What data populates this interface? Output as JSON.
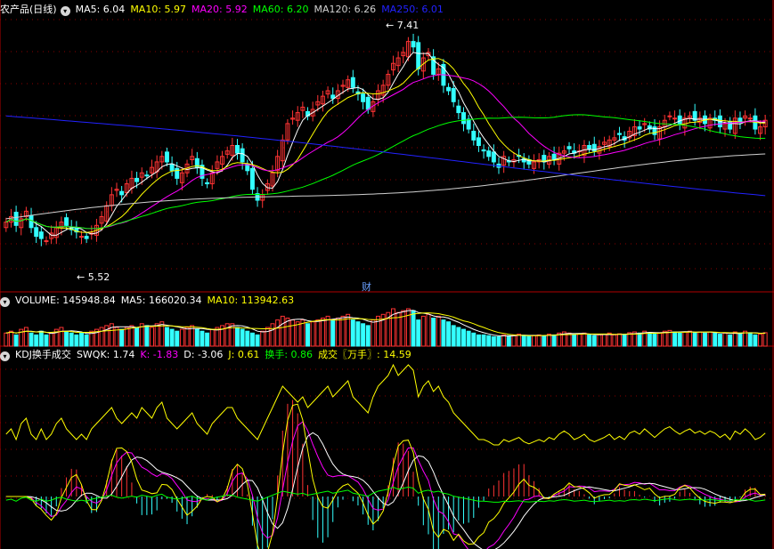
{
  "price_panel": {
    "title": "农产品(日线)",
    "ma": [
      {
        "label": "MA5: 6.04",
        "color": "#ffffff"
      },
      {
        "label": "MA10: 5.97",
        "color": "#ffff00"
      },
      {
        "label": "MA20: 5.92",
        "color": "#ff00ff"
      },
      {
        "label": "MA60: 6.20",
        "color": "#00ff00"
      },
      {
        "label": "MA120: 6.26",
        "color": "#d0d0d0"
      },
      {
        "label": "MA250: 6.01",
        "color": "#2222ff"
      }
    ],
    "high_label": "7.41",
    "low_label": "5.52",
    "marker": "财"
  },
  "volume_panel": {
    "items": [
      {
        "label": "VOLUME: 145948.84",
        "color": "#ffffff"
      },
      {
        "label": "MA5: 166020.34",
        "color": "#ffffff"
      },
      {
        "label": "MA10: 113942.63",
        "color": "#ffff00"
      }
    ]
  },
  "kdj_panel": {
    "items": [
      {
        "label": "KDJ换手成交",
        "color": "#ffffff"
      },
      {
        "label": "SWQK: 1.74",
        "color": "#ffffff"
      },
      {
        "label": "K: -1.83",
        "color": "#ff00ff"
      },
      {
        "label": "D: -3.06",
        "color": "#ffffff"
      },
      {
        "label": "J: 0.61",
        "color": "#ffff00"
      },
      {
        "label": "换手: 0.86",
        "color": "#00ff00"
      },
      {
        "label": "成交〖万手〗: 14.59",
        "color": "#ffff00"
      }
    ]
  },
  "chart_data": {
    "type": "candlestick",
    "colors": {
      "up": "#ff3333",
      "down": "#33ffff",
      "ma5": "#ffffff",
      "ma10": "#ffff00",
      "ma20": "#ff00ff",
      "ma60": "#00ff00",
      "ma120": "#d0d0d0",
      "ma250": "#2222ff"
    },
    "price_range": [
      5.3,
      7.6
    ],
    "closes": [
      5.75,
      5.8,
      5.72,
      5.78,
      5.85,
      5.7,
      5.62,
      5.6,
      5.58,
      5.65,
      5.7,
      5.75,
      5.72,
      5.68,
      5.66,
      5.62,
      5.6,
      5.65,
      5.72,
      5.8,
      5.9,
      6.0,
      6.05,
      6.0,
      6.1,
      6.15,
      6.12,
      6.2,
      6.18,
      6.25,
      6.3,
      6.35,
      6.3,
      6.22,
      6.15,
      6.2,
      6.28,
      6.35,
      6.25,
      6.15,
      6.1,
      6.2,
      6.3,
      6.35,
      6.4,
      6.45,
      6.38,
      6.3,
      6.22,
      6.05,
      5.95,
      6.0,
      6.1,
      6.2,
      6.35,
      6.5,
      6.65,
      6.7,
      6.75,
      6.8,
      6.72,
      6.78,
      6.85,
      6.9,
      6.95,
      6.88,
      6.95,
      7.0,
      7.05,
      6.98,
      6.92,
      6.85,
      6.78,
      6.85,
      6.95,
      7.0,
      7.1,
      7.2,
      7.25,
      7.3,
      7.4,
      7.35,
      7.15,
      7.25,
      7.3,
      7.1,
      7.15,
      7.0,
      6.95,
      6.85,
      6.75,
      6.65,
      6.6,
      6.5,
      6.45,
      6.4,
      6.35,
      6.3,
      6.25,
      6.35,
      6.3,
      6.32,
      6.35,
      6.3,
      6.28,
      6.3,
      6.32,
      6.3,
      6.35,
      6.32,
      6.38,
      6.4,
      6.42,
      6.38,
      6.4,
      6.45,
      6.42,
      6.4,
      6.44,
      6.48,
      6.5,
      6.52,
      6.55,
      6.5,
      6.58,
      6.62,
      6.6,
      6.65,
      6.6,
      6.55,
      6.62,
      6.68,
      6.72,
      6.7,
      6.65,
      6.7,
      6.72,
      6.68,
      6.7,
      6.65,
      6.7,
      6.68,
      6.62,
      6.65,
      6.6,
      6.7,
      6.66,
      6.72,
      6.7,
      6.6,
      6.62,
      6.68
    ],
    "volumes": [
      0.35,
      0.4,
      0.3,
      0.45,
      0.5,
      0.35,
      0.3,
      0.4,
      0.3,
      0.35,
      0.45,
      0.5,
      0.4,
      0.35,
      0.3,
      0.35,
      0.3,
      0.4,
      0.45,
      0.5,
      0.55,
      0.6,
      0.5,
      0.45,
      0.5,
      0.55,
      0.5,
      0.6,
      0.55,
      0.5,
      0.6,
      0.65,
      0.5,
      0.45,
      0.4,
      0.45,
      0.5,
      0.55,
      0.45,
      0.4,
      0.35,
      0.45,
      0.5,
      0.55,
      0.6,
      0.6,
      0.5,
      0.45,
      0.4,
      0.35,
      0.3,
      0.4,
      0.5,
      0.6,
      0.7,
      0.8,
      0.75,
      0.7,
      0.65,
      0.7,
      0.6,
      0.65,
      0.7,
      0.75,
      0.8,
      0.7,
      0.75,
      0.8,
      0.85,
      0.7,
      0.65,
      0.6,
      0.55,
      0.7,
      0.8,
      0.85,
      0.9,
      1.0,
      0.9,
      0.95,
      1.0,
      0.95,
      0.7,
      0.8,
      0.85,
      0.75,
      0.8,
      0.7,
      0.65,
      0.55,
      0.5,
      0.45,
      0.4,
      0.35,
      0.3,
      0.3,
      0.28,
      0.25,
      0.25,
      0.3,
      0.28,
      0.3,
      0.32,
      0.28,
      0.26,
      0.28,
      0.3,
      0.28,
      0.32,
      0.3,
      0.35,
      0.38,
      0.35,
      0.3,
      0.32,
      0.35,
      0.3,
      0.28,
      0.3,
      0.32,
      0.35,
      0.3,
      0.33,
      0.3,
      0.36,
      0.38,
      0.35,
      0.4,
      0.36,
      0.32,
      0.36,
      0.4,
      0.42,
      0.38,
      0.35,
      0.38,
      0.4,
      0.36,
      0.38,
      0.35,
      0.38,
      0.36,
      0.32,
      0.35,
      0.3,
      0.38,
      0.35,
      0.4,
      0.36,
      0.3,
      0.32,
      0.36
    ]
  }
}
